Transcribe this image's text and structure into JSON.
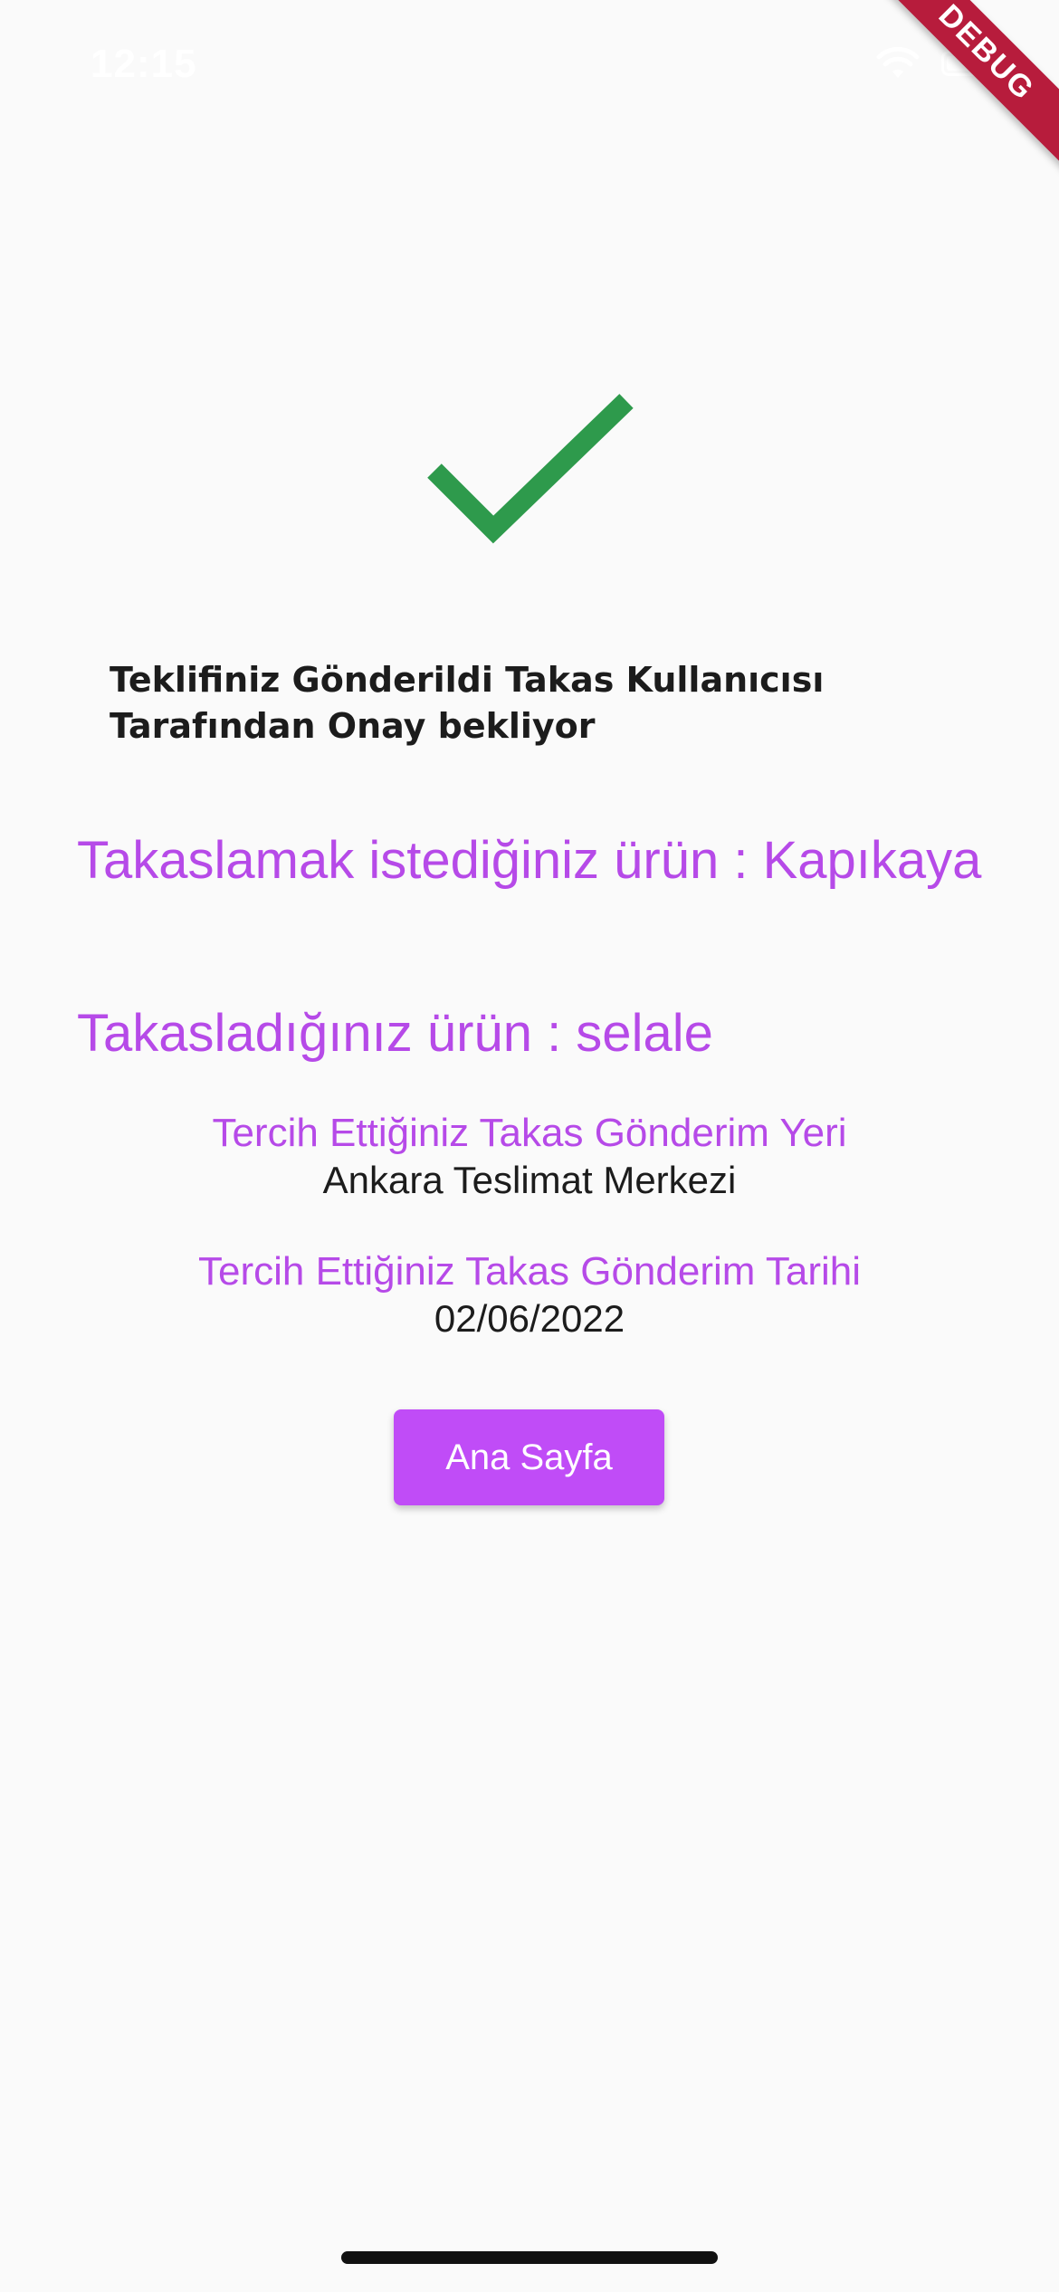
{
  "status_bar": {
    "time": "12:15",
    "wifi_icon": "wifi-icon",
    "battery_icon": "battery-icon"
  },
  "debug_banner": {
    "label": "DEBUG",
    "color": "#b71c3c"
  },
  "success": {
    "icon": "check-icon",
    "icon_color": "#2e9a4c",
    "headline": "Teklifiniz Gönderildi Takas Kullanıcısı Tarafından Onay bekliyor"
  },
  "products": {
    "wanted": "Takaslamak istediğiniz ürün : Kapıkaya",
    "own": "Takasladığınız ürün : selale"
  },
  "delivery": {
    "place_label": "Tercih Ettiğiniz Takas Gönderim Yeri",
    "place_value": "Ankara Teslimat Merkezi",
    "date_label": "Tercih Ettiğiniz Takas Gönderim Tarihi",
    "date_value": "02/06/2022"
  },
  "actions": {
    "home_label": "Ana Sayfa"
  },
  "colors": {
    "accent": "#c04cf7",
    "accent_text": "#b64ae8",
    "success": "#2e9a4c",
    "background": "#fafafa"
  }
}
